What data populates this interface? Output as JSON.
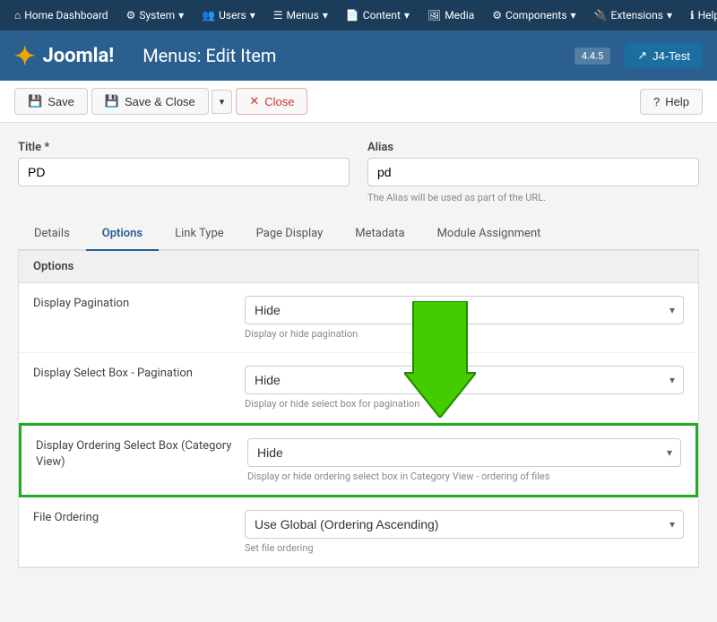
{
  "topbar": {
    "home": "Home Dashboard",
    "system": "System",
    "users": "Users",
    "menus": "Menus",
    "content": "Content",
    "media": "Media",
    "components": "Components",
    "extensions": "Extensions",
    "help": "Help"
  },
  "header": {
    "logo_text": "Joomla!",
    "title": "Menus: Edit Item",
    "version": "4.4.5",
    "env_label": "J4-Test"
  },
  "toolbar": {
    "save_label": "Save",
    "save_close_label": "Save & Close",
    "close_label": "Close",
    "help_label": "Help"
  },
  "form": {
    "title_label": "Title *",
    "title_value": "PD",
    "alias_label": "Alias",
    "alias_value": "pd",
    "alias_hint": "The Alias will be used as part of the URL."
  },
  "tabs": [
    {
      "id": "details",
      "label": "Details",
      "active": false
    },
    {
      "id": "options",
      "label": "Options",
      "active": true
    },
    {
      "id": "link-type",
      "label": "Link Type",
      "active": false
    },
    {
      "id": "page-display",
      "label": "Page Display",
      "active": false
    },
    {
      "id": "metadata",
      "label": "Metadata",
      "active": false
    },
    {
      "id": "module-assignment",
      "label": "Module Assignment",
      "active": false
    }
  ],
  "options_panel": {
    "header": "Options",
    "rows": [
      {
        "id": "display-pagination",
        "label": "Display Pagination",
        "value": "Hide",
        "hint": "Display or hide pagination",
        "highlighted": false
      },
      {
        "id": "display-select-box-pagination",
        "label": "Display Select Box - Pagination",
        "value": "Hide",
        "hint": "Display or hide select box for pagination",
        "highlighted": false
      },
      {
        "id": "display-ordering-select-box",
        "label": "Display Ordering Select Box (Category View)",
        "value": "Hide",
        "hint": "Display or hide ordering select box in Category View - ordering of files",
        "highlighted": true
      },
      {
        "id": "file-ordering",
        "label": "File Ordering",
        "value": "Use Global (Ordering Ascending)",
        "hint": "Set file ordering",
        "highlighted": false
      }
    ]
  }
}
